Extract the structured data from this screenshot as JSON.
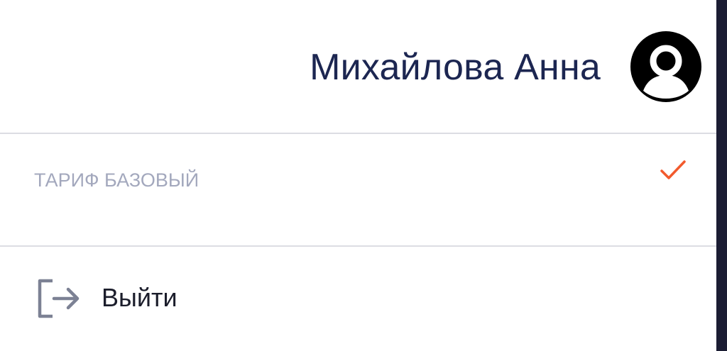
{
  "user": {
    "name": "Михайлова Анна",
    "avatar_icon": "user-avatar-icon"
  },
  "tariff": {
    "label": "Тариф базовый",
    "selected": true,
    "check_icon": "check-icon",
    "check_color": "#f25a2d"
  },
  "logout": {
    "label": "Выйти",
    "icon": "logout-icon"
  },
  "colors": {
    "name_text": "#1c2651",
    "muted_text": "#a3a8bd",
    "divider": "#dcdde3",
    "icon_gray": "#7c8194",
    "edge_dark": "#1b1d33"
  }
}
